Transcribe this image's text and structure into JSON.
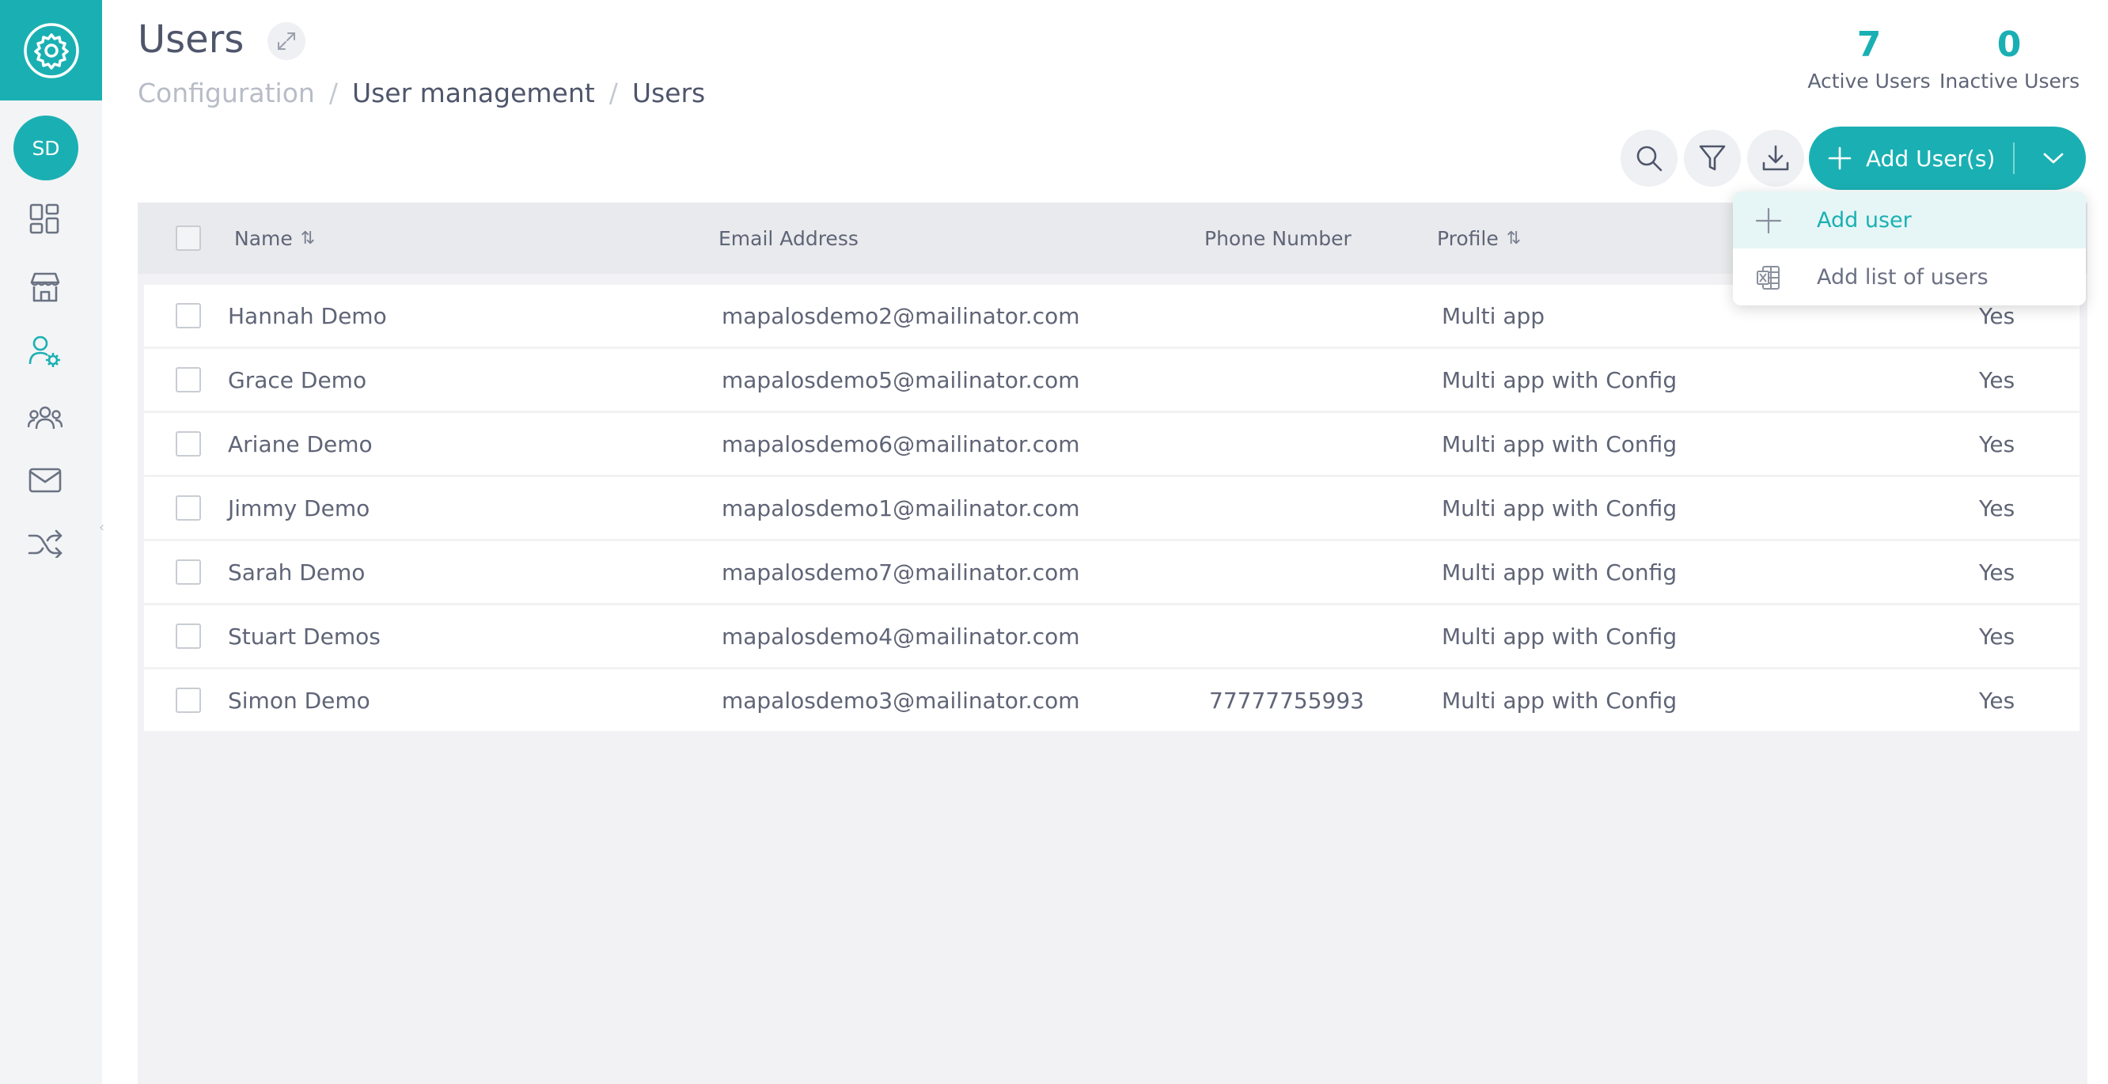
{
  "header": {
    "title": "Users",
    "breadcrumb": [
      "Configuration",
      "User management",
      "Users"
    ]
  },
  "stats": {
    "active": {
      "value": "7",
      "label": "Active Users"
    },
    "inactive": {
      "value": "0",
      "label": "Inactive Users"
    }
  },
  "sidebar": {
    "avatar_initials": "SD",
    "items": [
      {
        "icon": "dashboard-icon"
      },
      {
        "icon": "store-icon"
      },
      {
        "icon": "user-settings-icon"
      },
      {
        "icon": "groups-icon"
      },
      {
        "icon": "mail-icon"
      },
      {
        "icon": "shuffle-icon"
      }
    ]
  },
  "toolbar": {
    "add_label": "Add User(s)",
    "icons": [
      "search-icon",
      "filter-icon",
      "download-icon"
    ]
  },
  "dropdown": {
    "items": [
      {
        "label": "Add user",
        "icon": "plus-icon"
      },
      {
        "label": "Add list of users",
        "icon": "excel-icon"
      }
    ]
  },
  "table": {
    "columns": {
      "name": "Name",
      "email": "Email Address",
      "phone": "Phone Number",
      "profile": "Profile"
    },
    "rows": [
      {
        "name": "Hannah Demo",
        "email": "mapalosdemo2@mailinator.com",
        "phone": "",
        "profile": "Multi app",
        "active": "Yes"
      },
      {
        "name": "Grace Demo",
        "email": "mapalosdemo5@mailinator.com",
        "phone": "",
        "profile": "Multi app with Config",
        "active": "Yes"
      },
      {
        "name": "Ariane Demo",
        "email": "mapalosdemo6@mailinator.com",
        "phone": "",
        "profile": "Multi app with Config",
        "active": "Yes"
      },
      {
        "name": "Jimmy Demo",
        "email": "mapalosdemo1@mailinator.com",
        "phone": "",
        "profile": "Multi app with Config",
        "active": "Yes"
      },
      {
        "name": "Sarah Demo",
        "email": "mapalosdemo7@mailinator.com",
        "phone": "",
        "profile": "Multi app with Config",
        "active": "Yes"
      },
      {
        "name": "Stuart Demos",
        "email": "mapalosdemo4@mailinator.com",
        "phone": "",
        "profile": "Multi app with Config",
        "active": "Yes"
      },
      {
        "name": "Simon Demo",
        "email": "mapalosdemo3@mailinator.com",
        "phone": "77777755993",
        "profile": "Multi app with Config",
        "active": "Yes"
      }
    ]
  },
  "colors": {
    "accent": "#1ab0b3",
    "sidebar_bg": "#f3f4f6",
    "table_bg": "#f2f2f4"
  }
}
